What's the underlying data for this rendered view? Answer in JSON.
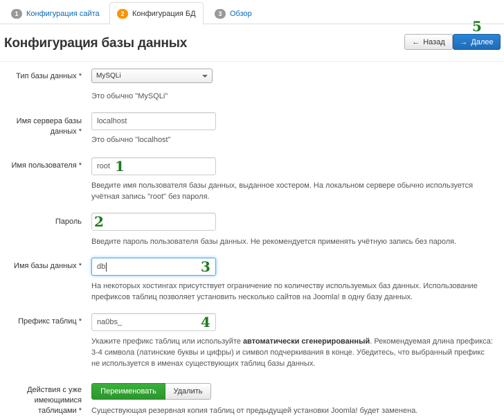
{
  "tabs": [
    {
      "num": "1",
      "label": "Конфигурация сайта"
    },
    {
      "num": "2",
      "label": "Конфигурация БД"
    },
    {
      "num": "3",
      "label": "Обзор"
    }
  ],
  "title": "Конфигурация базы данных",
  "buttons": {
    "prev": "Назад",
    "next": "Далее",
    "prev_icon": "←",
    "next_icon": "→"
  },
  "form": {
    "db_type": {
      "label": "Тип базы данных *",
      "value": "MySQLi",
      "help": "Это обычно \"MySQLi\""
    },
    "host": {
      "label_1": "Имя сервера базы",
      "label_2": "данных *",
      "value": "localhost",
      "help": "Это обычно \"localhost\""
    },
    "user": {
      "label": "Имя пользователя *",
      "value": "root",
      "help_1": "Введите имя пользователя базы данных, выданное хостером. На локальном сервере обычно используется",
      "help_2": "учётная запись \"root\" без пароля."
    },
    "password": {
      "label": "Пароль",
      "value": "",
      "help": "Введите пароль пользователя базы данных. Не рекомендуется применять учётную запись без пароля."
    },
    "db_name": {
      "label": "Имя базы данных *",
      "value": "db",
      "help_1": "На некоторых хостингах присутствует ограничение по количеству используемых баз данных. Использование",
      "help_2": "префиксов таблиц позволяет установить несколько сайтов на Joomla! в одну базу данных."
    },
    "prefix": {
      "label": "Префикс таблиц *",
      "value": "na0bs_",
      "help_1a": "Укажите префикс таблиц или используйте ",
      "help_1b": "автоматически сгенерированный",
      "help_1c": ". Рекомендуемая длина префикса:",
      "help_2": "3-4 символа (латинские буквы и цифры) и символ подчеркивания в конце. Убедитесь, что выбранный префикс",
      "help_3": "не используется в именах существующих таблиц базы данных."
    },
    "existing": {
      "label_1": "Действия с уже",
      "label_2": "имеющимися",
      "label_3": "таблицами *",
      "rename": "Переименовать",
      "delete": "Удалить",
      "help": "Существующая резервная копия таблиц от предыдущей установки Joomla! будет заменена."
    }
  },
  "markers": {
    "m1": "1",
    "m2": "2",
    "m3": "3",
    "m4": "4",
    "m5": "5"
  }
}
